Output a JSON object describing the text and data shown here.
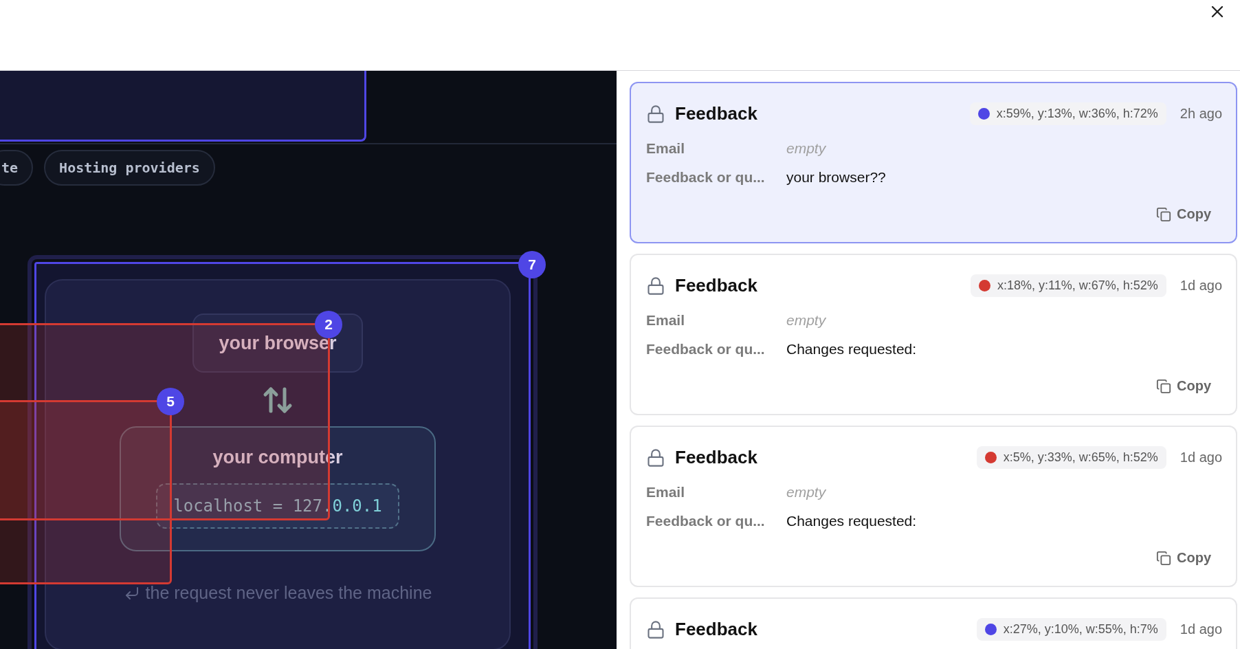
{
  "preview": {
    "chips": [
      {
        "label": "te"
      },
      {
        "label": "Hosting providers"
      }
    ],
    "diagram": {
      "browser_label": "your browser",
      "computer_label": "your computer",
      "address_host": "localhost = 127",
      "address_rest": ".0.0.1",
      "caption": "the request never leaves the machine"
    },
    "annotations": [
      {
        "number": "7",
        "color": "#4f46e5"
      },
      {
        "number": "2",
        "color": "#d43a32"
      },
      {
        "number": "5",
        "color": "#d43a32"
      }
    ]
  },
  "feedback": [
    {
      "title": "Feedback",
      "selected": true,
      "color": "#4f46e5",
      "region": "x:59%, y:13%, w:36%, h:72%",
      "time": "2h ago",
      "fields": [
        {
          "label": "Email",
          "value": "empty",
          "kind": "empty"
        },
        {
          "label": "Feedback or qu...",
          "value": "your browser??",
          "kind": "text"
        }
      ],
      "copy": "Copy"
    },
    {
      "title": "Feedback",
      "selected": false,
      "color": "#d43a32",
      "region": "x:18%, y:11%, w:67%, h:52%",
      "time": "1d ago",
      "fields": [
        {
          "label": "Email",
          "value": "empty",
          "kind": "empty"
        },
        {
          "label": "Feedback or qu...",
          "value": "Changes requested:",
          "kind": "text"
        }
      ],
      "copy": "Copy"
    },
    {
      "title": "Feedback",
      "selected": false,
      "color": "#d43a32",
      "region": "x:5%, y:33%, w:65%, h:52%",
      "time": "1d ago",
      "fields": [
        {
          "label": "Email",
          "value": "empty",
          "kind": "empty"
        },
        {
          "label": "Feedback or qu...",
          "value": "Changes requested:",
          "kind": "text"
        }
      ],
      "copy": "Copy"
    },
    {
      "title": "Feedback",
      "selected": false,
      "color": "#4f46e5",
      "region": "x:27%, y:10%, w:55%, h:7%",
      "time": "1d ago"
    }
  ]
}
